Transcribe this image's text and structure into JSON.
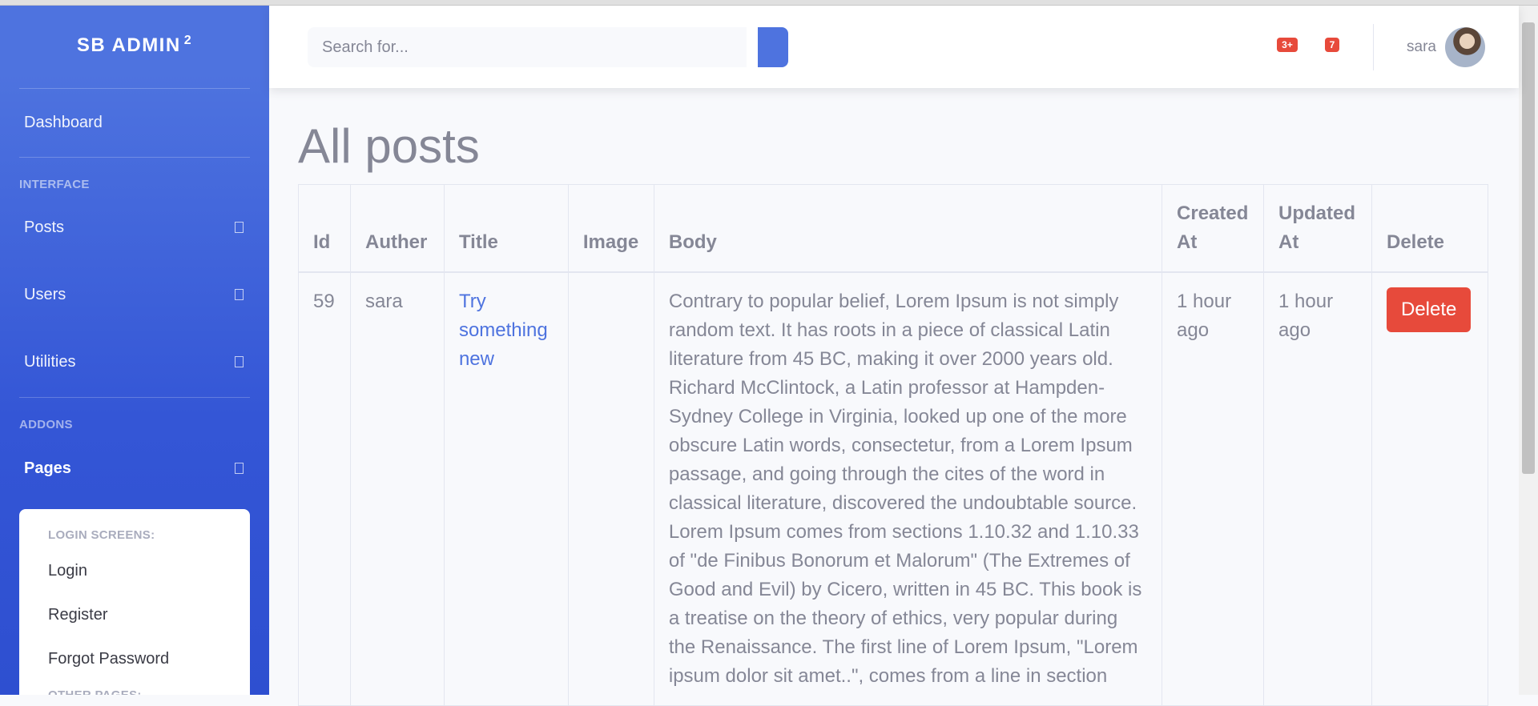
{
  "sidebar": {
    "brand": "SB ADMIN",
    "brand_sup": "2",
    "dashboard": "Dashboard",
    "section_interface": "INTERFACE",
    "posts": "Posts",
    "users": "Users",
    "utilities": "Utilities",
    "section_addons": "ADDONS",
    "pages": "Pages",
    "submenu": {
      "login_heading": "LOGIN SCREENS:",
      "login": "Login",
      "register": "Register",
      "forgot": "Forgot Password",
      "other_heading": "OTHER PAGES:"
    }
  },
  "topbar": {
    "search_placeholder": "Search for...",
    "alerts_badge": "3+",
    "messages_badge": "7",
    "username": "sara"
  },
  "main": {
    "title": "All posts",
    "table": {
      "headers": {
        "id": "Id",
        "author": "Auther",
        "title": "Title",
        "image": "Image",
        "body": "Body",
        "created": "Created At",
        "updated": "Updated At",
        "delete": "Delete"
      },
      "rows": [
        {
          "id": "59",
          "author": "sara",
          "title": "Try something new",
          "body": "Contrary to popular belief, Lorem Ipsum is not simply random text. It has roots in a piece of classical Latin literature from 45 BC, making it over 2000 years old. Richard McClintock, a Latin professor at Hampden-Sydney College in Virginia, looked up one of the more obscure Latin words, consectetur, from a Lorem Ipsum passage, and going through the cites of the word in classical literature, discovered the undoubtable source. Lorem Ipsum comes from sections 1.10.32 and 1.10.33 of \"de Finibus Bonorum et Malorum\" (The Extremes of Good and Evil) by Cicero, written in 45 BC. This book is a treatise on the theory of ethics, very popular during the Renaissance. The first line of Lorem Ipsum, \"Lorem ipsum dolor sit amet..\", comes from a line in section",
          "created": "1 hour ago",
          "updated": "1 hour ago",
          "delete_label": "Delete"
        }
      ]
    }
  }
}
